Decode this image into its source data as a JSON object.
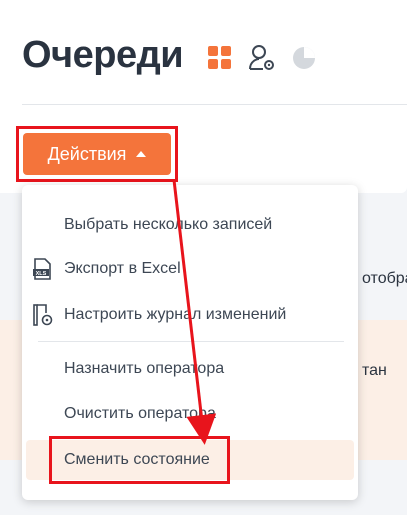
{
  "page": {
    "title": "Очереди"
  },
  "title_icons": [
    "grid-icon",
    "user-settings-icon",
    "pie-chart-icon"
  ],
  "actions_button": {
    "label": "Действия"
  },
  "menu": {
    "items": [
      {
        "label": "Выбрать несколько записей",
        "icon": ""
      },
      {
        "label": "Экспорт в Excel",
        "icon": "xls-file-icon"
      },
      {
        "label": "Настроить журнал изменений",
        "icon": "log-settings-icon"
      },
      {
        "label": "Назначить оператора",
        "icon": ""
      },
      {
        "label": "Очистить оператора",
        "icon": ""
      },
      {
        "label": "Сменить состояние",
        "icon": ""
      }
    ]
  },
  "background_text": {
    "right_1": "отобра",
    "right_2": "тан"
  },
  "colors": {
    "accent": "#f4743b",
    "highlight": "#e8141c",
    "menu_hover": "#fcefe6",
    "title": "#2a3340"
  }
}
